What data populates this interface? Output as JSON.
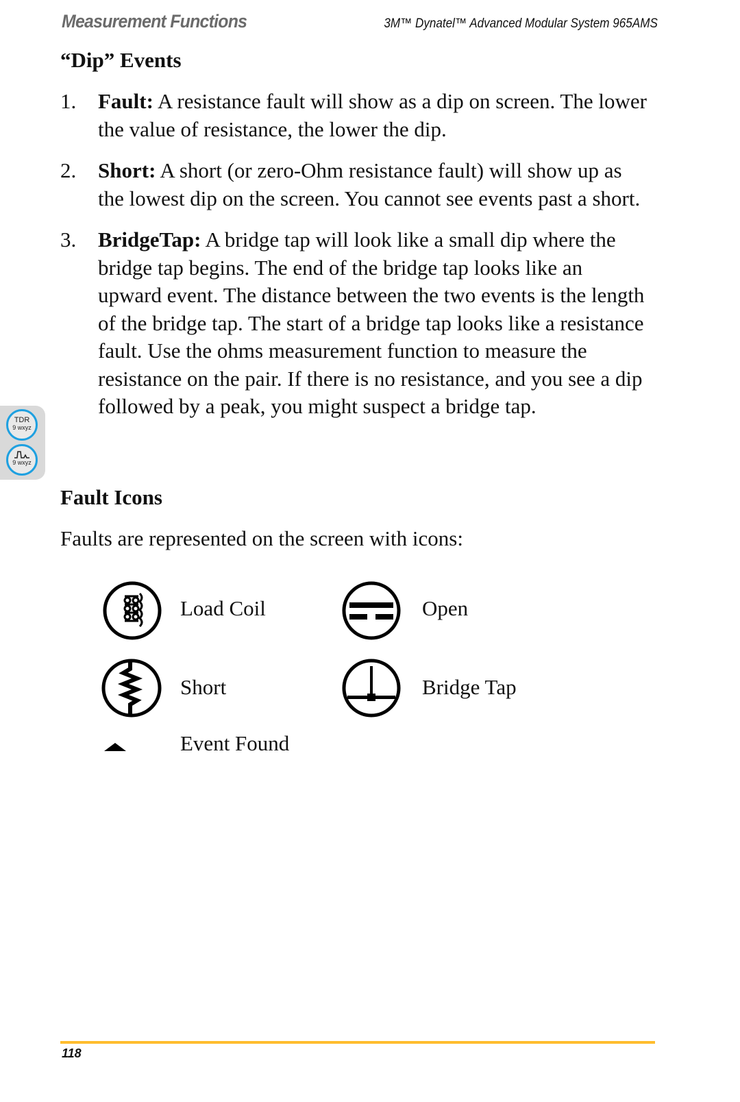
{
  "header": {
    "section_title": "Measurement Functions",
    "product_title": "3M™ Dynatel™ Advanced Modular System 965AMS"
  },
  "dip_events": {
    "heading": "“Dip” Events",
    "items": [
      {
        "num": "1.",
        "term": "Fault:",
        "text": " A resistance fault will show as a dip on screen. The lower the value of resistance, the lower the dip."
      },
      {
        "num": "2.",
        "term": "Short:",
        "text": " A short (or zero-Ohm resistance fault) will show up as the lowest dip on the screen. You cannot see events past a short."
      },
      {
        "num": "3.",
        "term": "BridgeTap:",
        "text": " A bridge tap will look like a small dip where the bridge tap begins. The end of the bridge tap looks like an upward event. The distance between the two events is the length of the bridge tap. The start of a bridge tap looks like a resistance fault. Use the ohms measurement function to measure the resistance on the pair. If there is no resistance, and you see a dip followed by a peak, you might suspect a bridge tap."
      }
    ]
  },
  "fault_icons": {
    "heading": "Fault Icons",
    "intro": "Faults are represented on the screen with icons:",
    "icons": [
      {
        "icon": "load-coil-icon",
        "label": "Load Coil"
      },
      {
        "icon": "open-icon",
        "label": "Open"
      },
      {
        "icon": "short-icon",
        "label": "Short"
      },
      {
        "icon": "bridge-tap-icon",
        "label": "Bridge Tap"
      },
      {
        "icon": "event-found-icon",
        "label": "Event Found"
      }
    ]
  },
  "side_tab": {
    "button1": {
      "line1": "TDR",
      "line2": "9 wxyz"
    },
    "button2": {
      "line2": "9 wxyz"
    }
  },
  "footer": {
    "page_number": "118",
    "rule_color": "#ffbd2e"
  }
}
